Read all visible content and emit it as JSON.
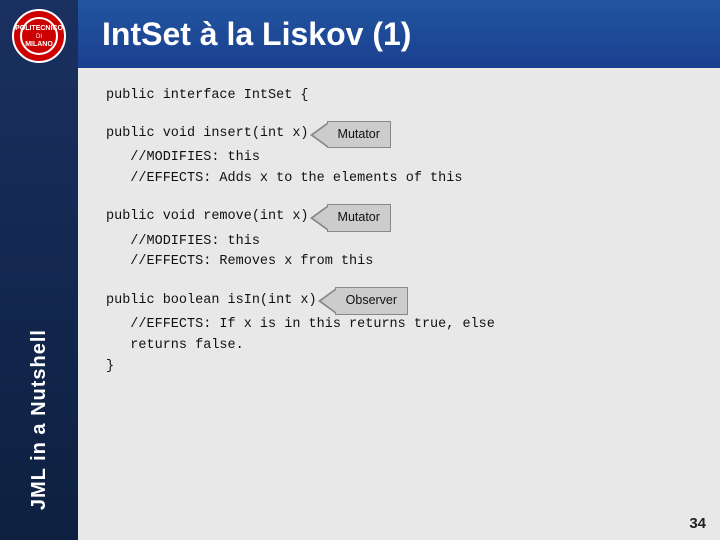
{
  "sidebar": {
    "text": "JML in a Nutshell"
  },
  "title": "IntSet à la Liskov (1)",
  "code": {
    "line1": "public interface IntSet {",
    "line2": "public void insert(int x)",
    "label_mutator1": "Mutator",
    "line3": "   //MODIFIES: this",
    "line4": "   //EFFECTS: Adds x to the elements of this",
    "line5": "public void remove(int x)",
    "label_mutator2": "Mutator",
    "line6": "   //MODIFIES: this",
    "line7": "   //EFFECTS: Removes x from this",
    "line8": "public boolean isIn(int x)",
    "label_observer": "Observer",
    "line9": "   //EFFECTS: If x is in this returns true, else",
    "line10": "   returns false.",
    "line11": "}"
  },
  "page_number": "34"
}
